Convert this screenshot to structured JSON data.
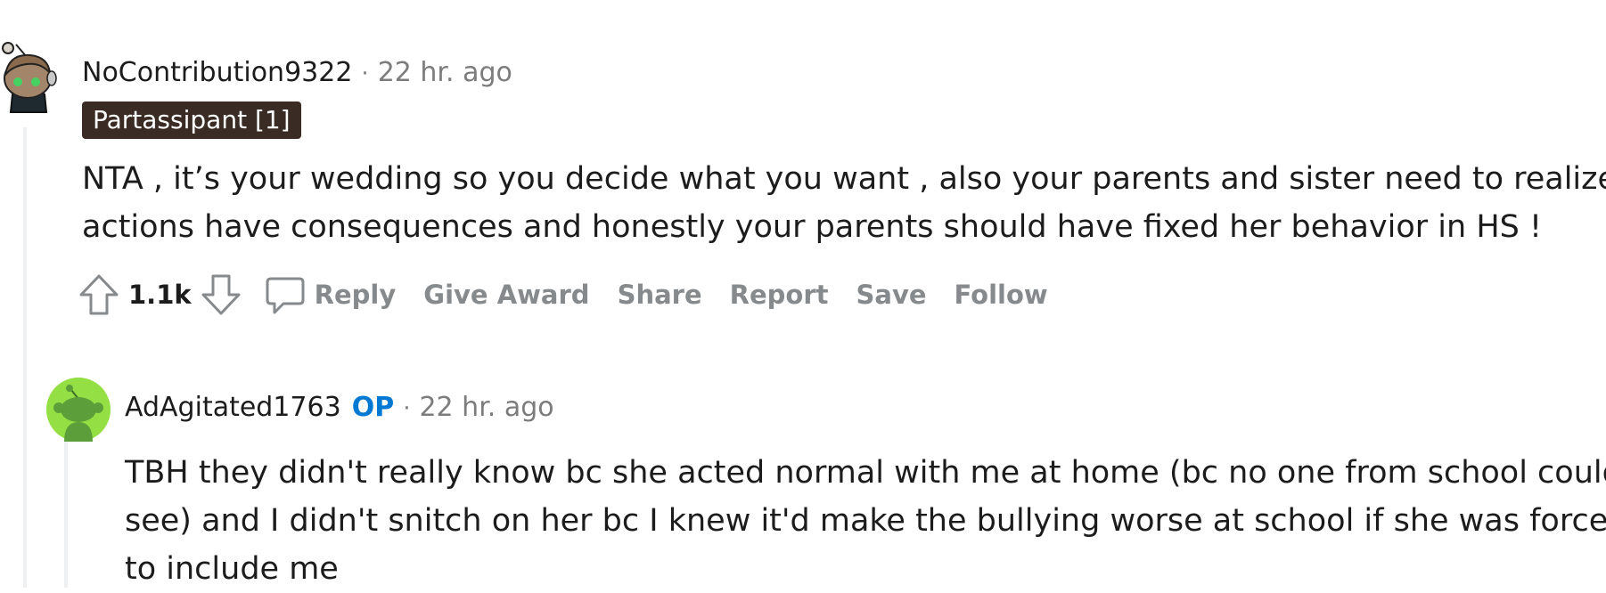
{
  "comments": [
    {
      "author": "NoContribution9322",
      "separator": "·",
      "time": "22 hr. ago",
      "flair": "Partassipant [1]",
      "body_lines": [
        "NTA , it’s your wedding so you decide what you want , also your parents and sister need to realize",
        "actions have consequences and honestly your parents should have fixed her behavior in HS !"
      ],
      "score": "1.1k",
      "actions": {
        "reply": "Reply",
        "give_award": "Give Award",
        "share": "Share",
        "report": "Report",
        "save": "Save",
        "follow": "Follow"
      },
      "avatar_colors": {
        "skin": "#a3866a",
        "hair": "#8a6a4c",
        "eyes": "#46d160",
        "shirt": "#1f2a30"
      }
    },
    {
      "author": "AdAgitated1763",
      "op_label": "OP",
      "separator": "·",
      "time": "22 hr. ago",
      "body_lines": [
        "TBH they didn't really know bc she acted normal with me at home (bc no one from school could",
        "see) and I didn't snitch on her bc I knew it'd make the bullying worse at school if she was forced",
        "to include me"
      ],
      "avatar_colors": {
        "background": "#94e044",
        "snoo": "#5c9e3a"
      }
    }
  ],
  "colors": {
    "flair_background": "#3a2c24",
    "op_blue": "#0079d3",
    "meta_gray": "#7c7c7c",
    "action_gray": "#878a8c",
    "thread_line": "#edeff1"
  }
}
